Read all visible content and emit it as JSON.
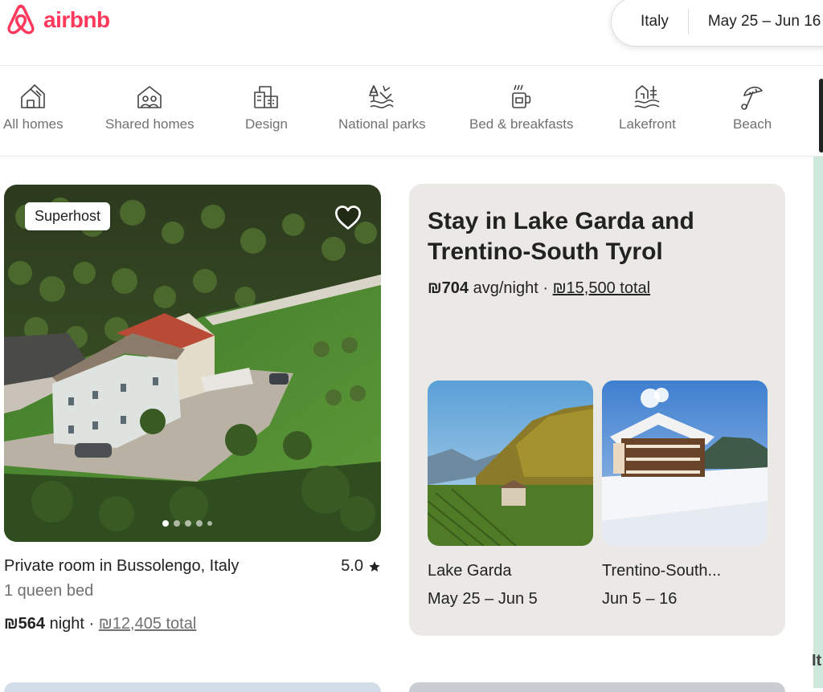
{
  "brand": {
    "name": "airbnb",
    "color": "#ff385c"
  },
  "search": {
    "location": "Italy",
    "dates": "May 25 – Jun 16"
  },
  "categories": [
    {
      "label": "All homes",
      "icon": "house-icon"
    },
    {
      "label": "Shared homes",
      "icon": "shared-homes-icon"
    },
    {
      "label": "Design",
      "icon": "design-building-icon"
    },
    {
      "label": "National parks",
      "icon": "national-parks-icon"
    },
    {
      "label": "Bed & breakfasts",
      "icon": "coffee-mug-icon"
    },
    {
      "label": "Lakefront",
      "icon": "lakefront-icon"
    },
    {
      "label": "Beach",
      "icon": "beach-umbrella-icon"
    }
  ],
  "listing": {
    "badge": "Superhost",
    "title": "Private room in Bussolengo, Italy",
    "rating": "5.0",
    "subtitle": "1 queen bed",
    "price": "₪564",
    "price_unit": "night",
    "separator": "·",
    "total": "₪12,405 total",
    "photo_count": 5,
    "photo_index": 1
  },
  "promo": {
    "title": "Stay in Lake Garda and Trentino-South Tyrol",
    "price": "₪704",
    "price_unit": "avg/night",
    "separator": "·",
    "total": "₪15,500 total",
    "destinations": [
      {
        "name": "Lake Garda",
        "dates": "May 25 – Jun 5"
      },
      {
        "name": "Trentino-South...",
        "dates": "Jun 5 – 16"
      }
    ]
  },
  "map": {
    "label": "It"
  }
}
